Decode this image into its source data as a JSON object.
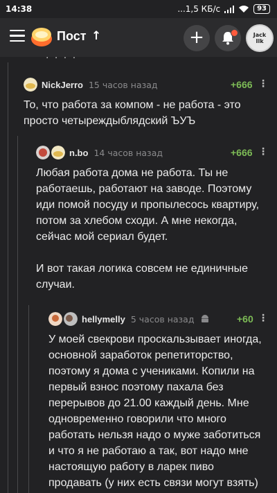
{
  "status_bar": {
    "time": "14:38",
    "network": "...1,5 КБ/с",
    "battery": "93"
  },
  "header": {
    "title": "Пост",
    "avatar_text": "Jack Ilk"
  },
  "comments": [
    {
      "username": "NickJerro",
      "time": "15 часов назад",
      "rating": "+666",
      "text": "То, что работа за компом - не работа - это просто четыреждыблядский ЪУЪ"
    },
    {
      "username": "n.bo",
      "time": "14 часов назад",
      "rating": "+666",
      "text": "Любая работа дома не работа. Ты не работаешь, работают на заводе. Поэтому иди помой посуду и пропылесось квартиру, потом за хлебом сходи. А мне некогда, сейчас мой сериал будет.\n\nИ вот такая логика совсем не единичные случаи."
    },
    {
      "username": "hellymelly",
      "time": "5 часов назад",
      "rating": "+60",
      "text": "У моей свекрови проскальзывает иногда, основной заработок репетиторство, поэтому я дома с учениками. Копили на первый взнос поэтому пахала без перерывов до 21.00 каждый день. Мне одновременно говорили что много работать нельзя надо о муже заботиться и что я не работаю а так, вот надо мне настоящую работу в ларек пиво продавать (у них есть связи могут взять)"
    }
  ],
  "colors": {
    "background": "#222224",
    "rating_green": "#7dbb56",
    "accent_orange": "#ff5a3c"
  }
}
